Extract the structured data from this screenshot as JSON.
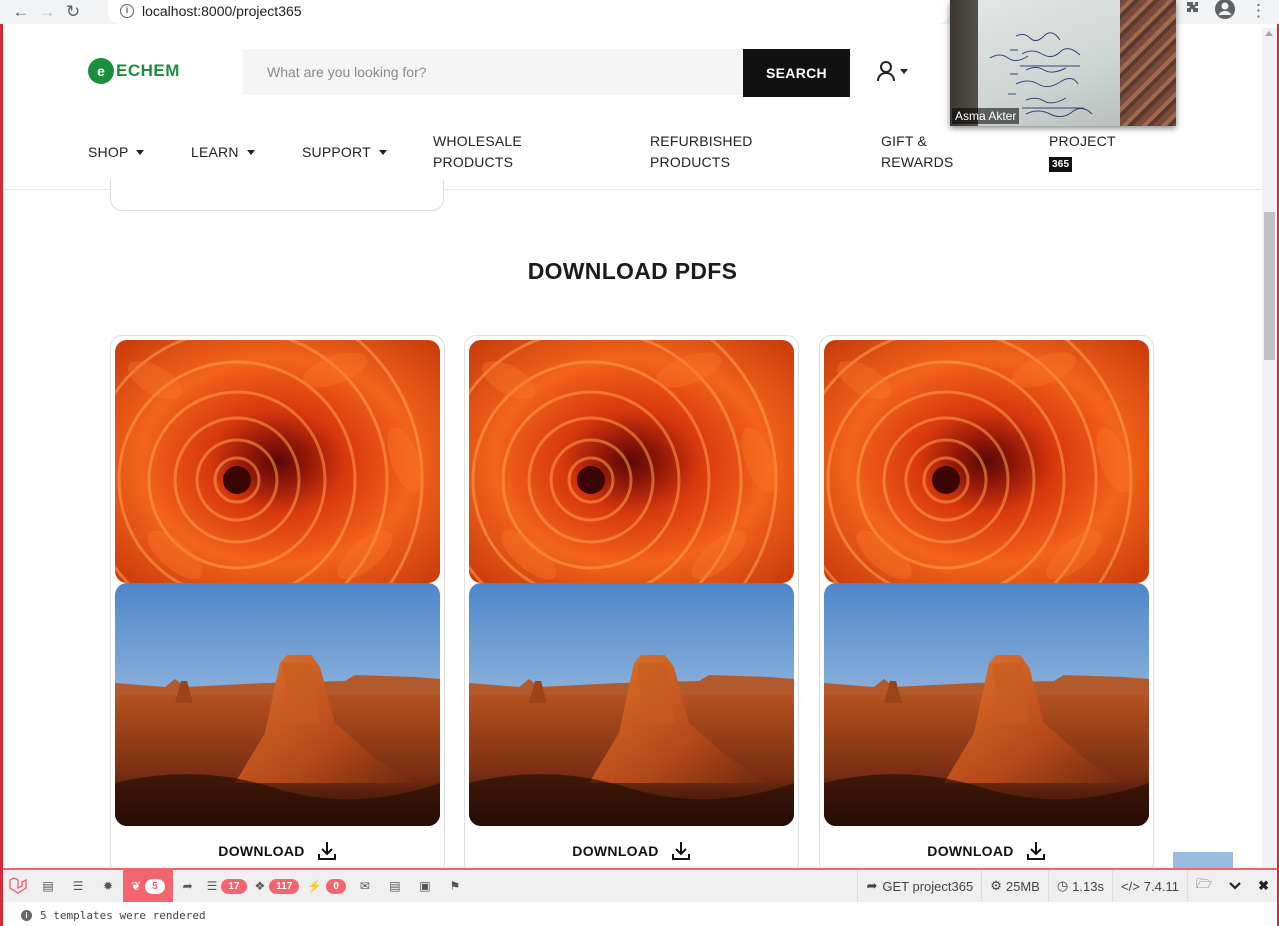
{
  "browser": {
    "url": "localhost:8000/project365"
  },
  "header": {
    "logo_mark": "e",
    "logo_text": "ECHEM",
    "search_placeholder": "What are you looking for?",
    "search_button": "SEARCH",
    "nav": [
      {
        "label": "SHOP"
      },
      {
        "label": "LEARN"
      },
      {
        "label": "SUPPORT"
      },
      {
        "line1": "WHOLESALE",
        "line2": "PRODUCTS"
      },
      {
        "line1": "REFURBISHED",
        "line2": "PRODUCTS"
      },
      {
        "line1": "GIFT &",
        "line2": "REWARDS"
      },
      {
        "line1": "PROJECT",
        "badge": "365"
      }
    ]
  },
  "video": {
    "participant": "Asma Akter"
  },
  "main": {
    "section_title": "DOWNLOAD PDFS",
    "cards": [
      {
        "download_label": "DOWNLOAD"
      },
      {
        "download_label": "DOWNLOAD"
      },
      {
        "download_label": "DOWNLOAD"
      }
    ]
  },
  "debugbar": {
    "views_count": "5",
    "queries_count": "17",
    "models_count": "117",
    "events_count": "0",
    "route": "GET project365",
    "memory": "25MB",
    "time": "1.13s",
    "php_version": "7.4.11",
    "status_message": "5 templates were rendered"
  }
}
